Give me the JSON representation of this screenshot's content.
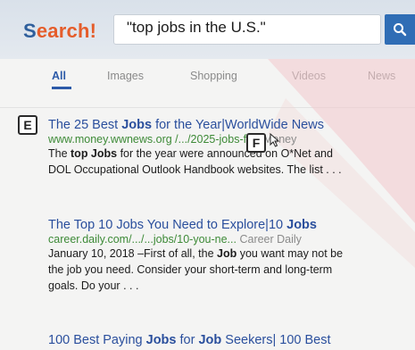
{
  "search": {
    "logo": "Search!",
    "logo_first": "S",
    "logo_rest": "earch!",
    "query": "\"top jobs in the U.S.\"",
    "button_icon": "magnifier-icon"
  },
  "tabs": [
    {
      "label": "All",
      "active": true
    },
    {
      "label": "Images",
      "active": false
    },
    {
      "label": "Shopping",
      "active": false
    },
    {
      "label": "Videos",
      "active": false
    },
    {
      "label": "News",
      "active": false
    }
  ],
  "markers": {
    "e": "E",
    "f": "F"
  },
  "results": [
    {
      "title_pre": "The 25 Best ",
      "title_bold": "Jobs",
      "title_post": " for the Year|WorldWide News",
      "url": "www.money.wwnews.org /.../2025-jobs-for-",
      "source": "Money",
      "snippet_1_pre": "The ",
      "snippet_1_bold": "top Jobs",
      "snippet_1_post": " for the year were announced on O*Net and",
      "snippet_2": "DOL Occupational Outlook Handbook websites. The list . . ."
    },
    {
      "title_pre": "The Top 10 Jobs You Need to Explore|10 ",
      "title_bold": "Jobs",
      "url": "career.daily.com/.../...jobs/10-you-ne...",
      "source": "Career Daily",
      "snippet_1_pre": "January 10, 2018 –First of all, the ",
      "snippet_1_bold": "Job",
      "snippet_1_post": " you want may not be",
      "snippet_2": "the job you need. Consider your short-term and long-term",
      "snippet_3": "goals. Do your . . ."
    },
    {
      "title_pre": "100 Best Paying ",
      "title_bold": "Jobs",
      "title_mid": " for ",
      "title_bold2": "Job",
      "title_post": " Seekers| 100 Best"
    }
  ],
  "colors": {
    "accent": "#2c5aa8",
    "logo_orange": "#e55d2b",
    "url_green": "#3d8a37"
  }
}
